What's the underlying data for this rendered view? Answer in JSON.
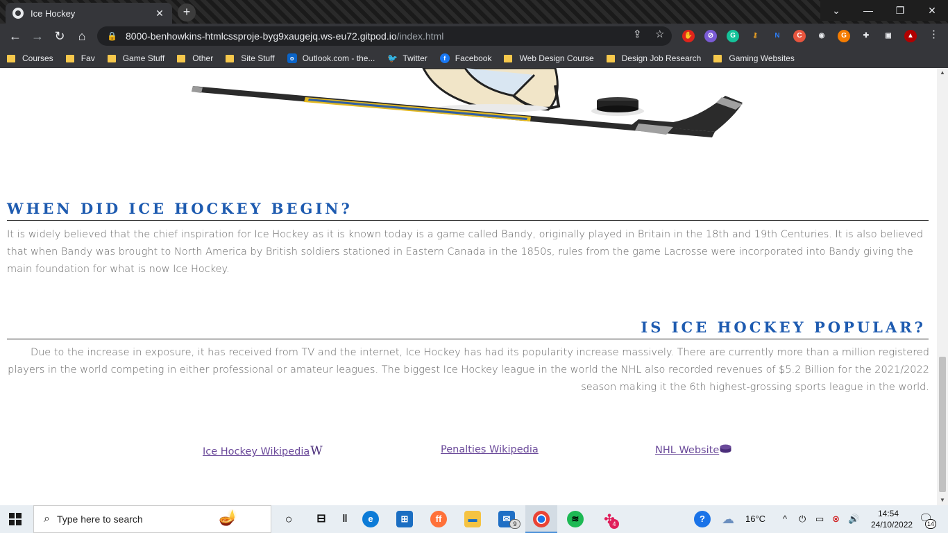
{
  "browser": {
    "tab_title": "Ice Hockey",
    "tab_close": "✕",
    "new_tab": "+",
    "url_host": "8000-benhowkins-htmlcssproje-byg9xaugejq.ws-eu72.gitpod.io",
    "url_path": "/index.html",
    "bookmarks": [
      {
        "label": "Courses",
        "icon": "folder-icon"
      },
      {
        "label": "Fav",
        "icon": "folder-icon"
      },
      {
        "label": "Game Stuff",
        "icon": "folder-icon"
      },
      {
        "label": "Other",
        "icon": "folder-icon"
      },
      {
        "label": "Site Stuff",
        "icon": "folder-icon"
      },
      {
        "label": "Outlook.com - the...",
        "icon": "outlook-icon"
      },
      {
        "label": "Twitter",
        "icon": "twitter-icon"
      },
      {
        "label": "Facebook",
        "icon": "facebook-icon"
      },
      {
        "label": "Web Design Course",
        "icon": "folder-icon"
      },
      {
        "label": "Design Job Research",
        "icon": "folder-icon"
      },
      {
        "label": "Gaming Websites",
        "icon": "folder-icon"
      }
    ]
  },
  "page": {
    "section1": {
      "title": "WHEN DID ICE HOCKEY BEGIN?",
      "text": "It is widely believed that the chief inspiration for Ice Hockey as it is known today is a game called Bandy, originally played in Britain in the 18th and 19th Centuries. It is also believed that when Bandy was brought to North America by British soldiers stationed in Eastern Canada in the 1850s, rules from the game Lacrosse were incorporated into Bandy giving the main foundation for what is now Ice Hockey."
    },
    "section2": {
      "title": "IS ICE HOCKEY POPULAR?",
      "text": "Due to the increase in exposure, it has received from TV and the internet, Ice Hockey has had its popularity increase massively. There are currently more than a million registered players in the world competing in either professional or amateur leagues. The biggest Ice Hockey league in the world the NHL also recorded revenues of $5.2 Billion for the 2021/2022 season making it the 6th highest-grossing sports league in the world."
    },
    "links": [
      {
        "label": "Ice Hockey Wikipedia",
        "icon": "W"
      },
      {
        "label": "Penalties Wikipedia",
        "icon": ""
      },
      {
        "label": "NHL Website",
        "icon": "hockey-puck-icon"
      }
    ]
  },
  "taskbar": {
    "search_placeholder": "Type here to search",
    "weather": "16°C",
    "time": "14:54",
    "date": "24/10/2022",
    "mail_badge": "9",
    "slack_badge": "4",
    "notification_count": "14"
  }
}
